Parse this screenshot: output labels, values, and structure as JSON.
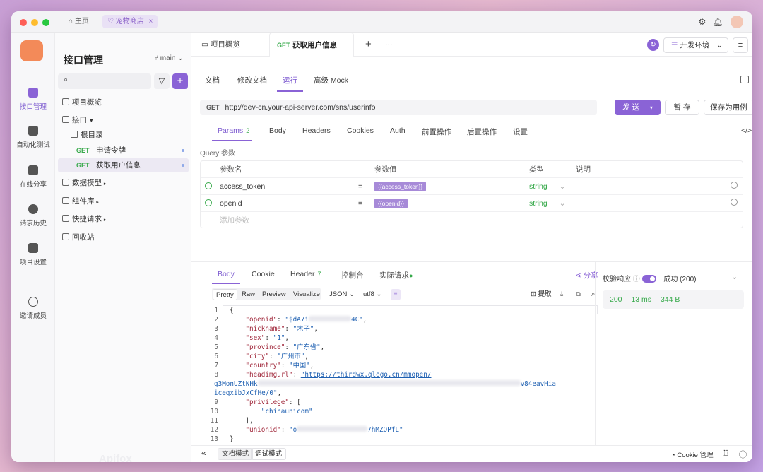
{
  "titlebar": {
    "home_label": "主页",
    "active_tab": "宠物商店"
  },
  "rail": [
    "接口管理",
    "自动化测试",
    "在线分享",
    "请求历史",
    "项目设置",
    "邀请成员"
  ],
  "sidebar": {
    "title": "接口管理",
    "branch": "main",
    "items": {
      "overview": "项目概览",
      "api": "接口",
      "root": "根目录",
      "ep1_method": "GET",
      "ep1_name": "申请令牌",
      "ep2_method": "GET",
      "ep2_name": "获取用户信息",
      "models": "数据模型",
      "components": "组件库",
      "quick": "快捷请求",
      "trash": "回收站"
    },
    "brand": "Apifox"
  },
  "doc_tabs": {
    "overview": "项目概览",
    "active_method": "GET",
    "active_name": "获取用户信息"
  },
  "env": "开发环境",
  "sub_tabs": [
    "文档",
    "修改文档",
    "运行",
    "高级 Mock"
  ],
  "request": {
    "method": "GET",
    "url": "http://dev-cn.your-api-server.com/sns/userinfo",
    "send": "发 送",
    "save": "暂 存",
    "save_case": "保存为用例"
  },
  "param_tabs": {
    "params": "Params",
    "params_count": "2",
    "body": "Body",
    "headers": "Headers",
    "cookies": "Cookies",
    "auth": "Auth",
    "pre": "前置操作",
    "post": "后置操作",
    "settings": "设置"
  },
  "query": {
    "label": "Query 参数",
    "headers": {
      "name": "参数名",
      "value": "参数值",
      "type": "类型",
      "desc": "说明"
    },
    "rows": [
      {
        "name": "access_token",
        "eq": "=",
        "value": "{{access_token}}",
        "type": "string"
      },
      {
        "name": "openid",
        "eq": "=",
        "value": "{{openid}}",
        "type": "string"
      }
    ],
    "add": "添加参数"
  },
  "response_tabs": {
    "body": "Body",
    "cookie": "Cookie",
    "header": "Header",
    "header_count": "7",
    "console": "控制台",
    "actual": "实际请求",
    "share": "分享"
  },
  "format": {
    "pretty": "Pretty",
    "raw": "Raw",
    "preview": "Preview",
    "visualize": "Visualize",
    "json": "JSON",
    "utf8": "utf8",
    "extract": "提取"
  },
  "code_lines": {
    "l1": "{",
    "l2k": "\"openid\"",
    "l2a": "\"$dA7i",
    "l2b": "4C\"",
    "l3k": "\"nickname\"",
    "l3v": "\"木子\"",
    "l4k": "\"sex\"",
    "l4v": "\"1\"",
    "l5k": "\"province\"",
    "l5v": "\"广东省\"",
    "l6k": "\"city\"",
    "l6v": "\"广州市\"",
    "l7k": "\"country\"",
    "l7v": "\"中国\"",
    "l8k": "\"headimgurl\"",
    "l8v": "\"https://thirdwx.qlogo.cn/mmopen/",
    "l8b": "g3MonUZtNHk",
    "l8c": "v84eavHia",
    "l8d": "iceqxibJxCfHe/0\"",
    "l9k": "\"privilege\"",
    "l9v": "[",
    "l10": "\"chinaunicom\"",
    "l11": "],",
    "l12k": "\"unionid\"",
    "l12a": "\"o",
    "l12b": "7hMZOPfL\"",
    "l13": "}"
  },
  "line_numbers": [
    "1",
    "2",
    "3",
    "4",
    "5",
    "6",
    "7",
    "8",
    "9",
    "10",
    "11",
    "12",
    "13"
  ],
  "validation": {
    "label": "校验响应",
    "status": "成功 (200)",
    "code": "200",
    "time": "13 ms",
    "size": "344 B"
  },
  "bottom": {
    "doc_mode": "文档模式",
    "debug_mode": "调试模式",
    "cookie_mgmt": "Cookie 管理"
  },
  "colors": {
    "accent": "#8a63d6",
    "success": "#36a94a"
  }
}
